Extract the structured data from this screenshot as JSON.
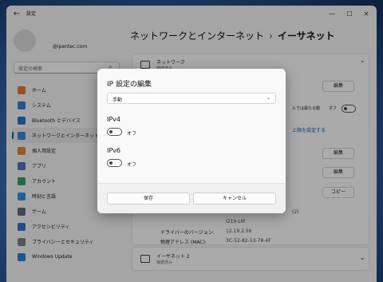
{
  "window": {
    "title": "設定",
    "back": "←",
    "minimize": "—",
    "maximize": "☐",
    "close": "✕"
  },
  "account": {
    "email": "@ipentec.com"
  },
  "search": {
    "placeholder": "設定の検索",
    "icon": "search-icon"
  },
  "sidebar": {
    "items": [
      {
        "label": "ホーム",
        "color": "#e27a2c"
      },
      {
        "label": "システム",
        "color": "#3b7bd4"
      },
      {
        "label": "Bluetooth とデバイス",
        "color": "#2f74c8"
      },
      {
        "label": "ネットワークとインターネット",
        "color": "#3a86d6"
      },
      {
        "label": "個人用設定",
        "color": "#d8892f"
      },
      {
        "label": "アプリ",
        "color": "#5d6fb0"
      },
      {
        "label": "アカウント",
        "color": "#2f9f6b"
      },
      {
        "label": "時刻と言語",
        "color": "#2b8fd9"
      },
      {
        "label": "ゲーム",
        "color": "#5f6b78"
      },
      {
        "label": "アクセシビリティ",
        "color": "#3a6fc9"
      },
      {
        "label": "プライバシーとセキュリティ",
        "color": "#7a7f88"
      },
      {
        "label": "Windows Update",
        "color": "#2b7fd6"
      }
    ]
  },
  "header": {
    "parent": "ネットワークとインターネット",
    "separator": "›",
    "current": "イーサネット"
  },
  "ethernet_card": {
    "title": "ネットワーク",
    "subtitle": "接続済み"
  },
  "background": {
    "edit_button_1": "編集",
    "metered_text": "ルでは異なる動",
    "off_label": "オフ",
    "data_limit_link": "上限を設定する",
    "edit_button_2": "編集",
    "edit_button_3": "編集",
    "copy_button": "コピー",
    "partial_value_1": "(2)",
    "partial_value_2": "I219-LM",
    "driver_label": "ドライバーのバージョン:",
    "driver_value": "12.19.2.56",
    "mac_label": "物理アドレス (MAC):",
    "mac_value": "3C-52-82-53-78-4F"
  },
  "ethernet2_card": {
    "title": "イーサネット 2",
    "subtitle": "接続済み"
  },
  "dialog": {
    "title": "IP 設定の編集",
    "mode_value": "手動",
    "ipv4_title": "IPv4",
    "ipv4_state": "オフ",
    "ipv6_title": "IPv6",
    "ipv6_state": "オフ",
    "save_label": "保存",
    "cancel_label": "キャンセル"
  }
}
